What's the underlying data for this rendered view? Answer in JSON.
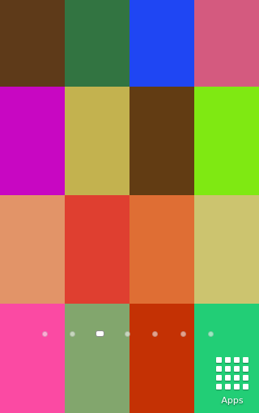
{
  "wallpaper": {
    "rows": [
      [
        "#5e3a19",
        "#327441",
        "#1f46f3",
        "#d45a7f"
      ],
      [
        "#c807c2",
        "#c3b24f",
        "#623c13",
        "#7fe912"
      ],
      [
        "#e29468",
        "#df3f30",
        "#df6e34",
        "#ccc46f"
      ],
      [
        "#fb4aa3",
        "#82a66d",
        "#c43104",
        "#22ce76"
      ]
    ]
  },
  "pager": {
    "page_count": 7,
    "current_page": 3
  },
  "dock": {
    "apps_label": "Apps",
    "apps_icon": "app-grid-icon"
  }
}
